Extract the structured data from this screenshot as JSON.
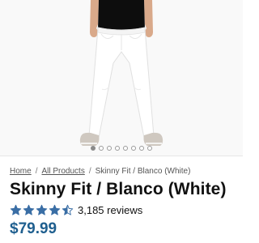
{
  "product": {
    "image_alt": "Skinny Fit / Blanco (White)",
    "carousel_total": 8,
    "carousel_active": 0,
    "title": "Skinny Fit / Blanco (White)",
    "rating": 4.5,
    "rating_max": 5,
    "reviews_text": "3,185 reviews",
    "price": "$79.99"
  },
  "breadcrumb": {
    "items": [
      "Home",
      "All Products",
      "Skinny Fit / Blanco (White)"
    ],
    "separator": "/"
  },
  "colors": {
    "star": "#3a6ea5",
    "price": "#1f5f8f",
    "text": "#111111"
  }
}
